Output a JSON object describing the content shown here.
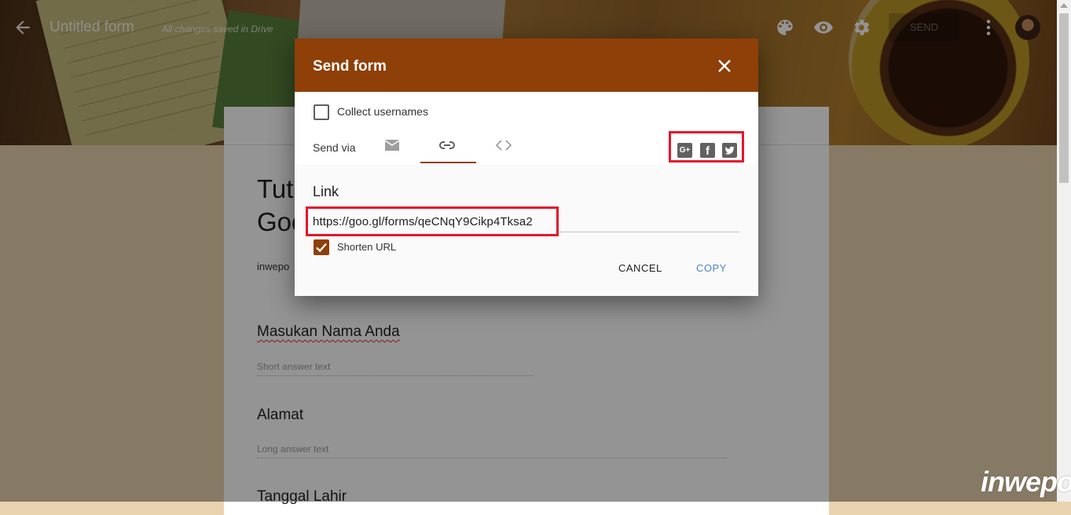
{
  "topbar": {
    "form_title": "Untitled form",
    "save_status": "All changes saved in Drive",
    "send_label": "SEND"
  },
  "form": {
    "title_partial_line1": "Tut",
    "title_partial_line2": "Goo",
    "description_partial": "inwepo",
    "questions": [
      {
        "title": "Masukan Nama Anda",
        "hint": "Short answer text"
      },
      {
        "title": "Alamat",
        "hint": "Long answer text"
      },
      {
        "title": "Tanggal Lahir",
        "hint": ""
      }
    ]
  },
  "dialog": {
    "title": "Send form",
    "collect_usernames_label": "Collect usernames",
    "collect_usernames_checked": false,
    "send_via_label": "Send via",
    "tabs": [
      {
        "icon": "email-icon",
        "active": false
      },
      {
        "icon": "link-icon",
        "active": true
      },
      {
        "icon": "embed-code-icon",
        "active": false
      }
    ],
    "share": [
      {
        "icon": "google-plus-icon",
        "glyph": "G+"
      },
      {
        "icon": "facebook-icon",
        "glyph": "f"
      },
      {
        "icon": "twitter-icon",
        "glyph": "t"
      }
    ],
    "link_label": "Link",
    "link_url": "https://goo.gl/forms/qeCNqY9Cikp4Tksa2",
    "shorten_url_label": "Shorten URL",
    "shorten_url_checked": true,
    "cancel_label": "CANCEL",
    "copy_label": "COPY"
  },
  "watermark": "inwepo",
  "colors": {
    "theme": "#8f3f08",
    "highlight_box": "#e3172d",
    "copy_button": "#4d84c7"
  }
}
